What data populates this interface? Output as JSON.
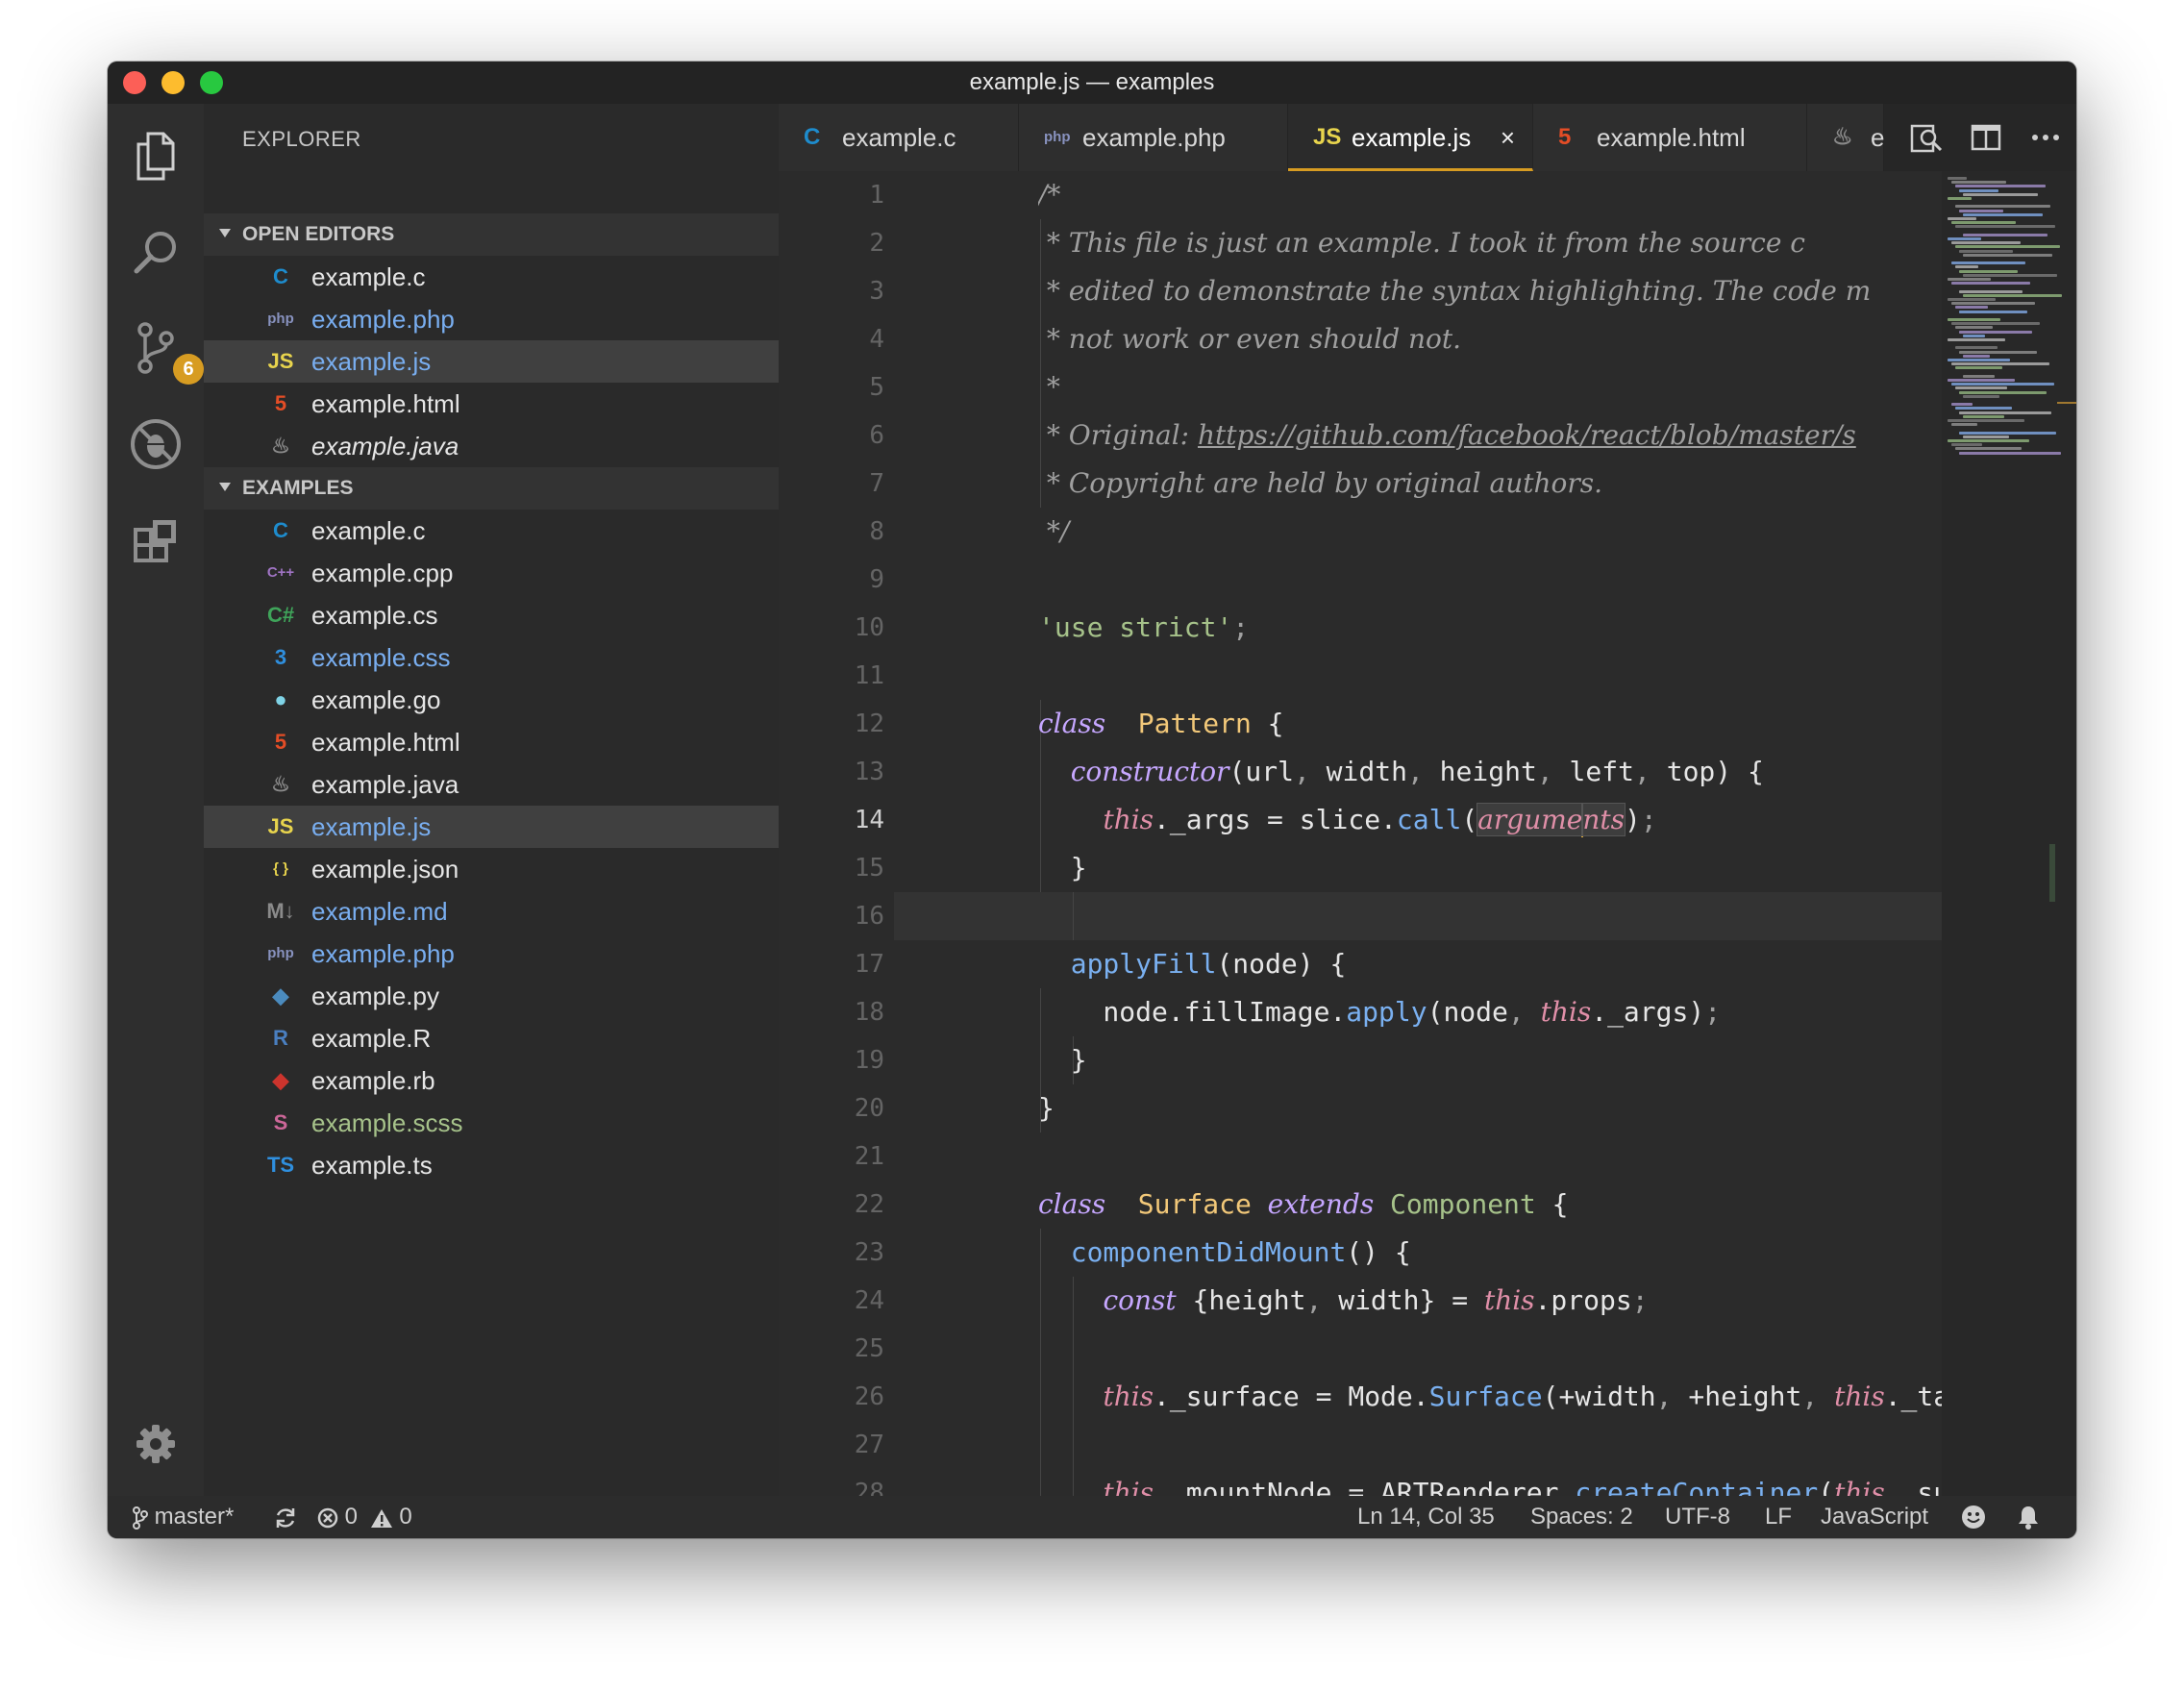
{
  "window": {
    "title": "example.js — examples"
  },
  "activity_bar": {
    "items": [
      {
        "icon": "explorer-icon",
        "active": true
      },
      {
        "icon": "search-icon"
      },
      {
        "icon": "source-control-icon",
        "badge": "6"
      },
      {
        "icon": "debug-icon"
      },
      {
        "icon": "extensions-icon"
      }
    ],
    "settings_icon": "gear-icon"
  },
  "sidebar": {
    "title": "EXPLORER",
    "open_editors": {
      "header": "OPEN EDITORS",
      "items": [
        {
          "name": "example.c",
          "icon": "C",
          "icon_color": "#1e8ccd",
          "text_color": "#e6e6e6"
        },
        {
          "name": "example.php",
          "icon": "php",
          "icon_color": "#8892bf",
          "text_color": "#79aef0"
        },
        {
          "name": "example.js",
          "icon": "JS",
          "icon_color": "#e8d44d",
          "text_color": "#79aef0",
          "selected": true
        },
        {
          "name": "example.html",
          "icon": "5",
          "icon_color": "#e44d26",
          "text_color": "#e6e6e6"
        },
        {
          "name": "example.java",
          "icon": "♨",
          "icon_color": "#8a8a8a",
          "text_color": "#e6e6e6",
          "italic": true
        }
      ]
    },
    "examples": {
      "header": "EXAMPLES",
      "items": [
        {
          "name": "example.c",
          "icon": "C",
          "icon_color": "#1e8ccd",
          "text_color": "#e6e6e6"
        },
        {
          "name": "example.cpp",
          "icon": "C++",
          "icon_color": "#a074c4",
          "text_color": "#e6e6e6"
        },
        {
          "name": "example.cs",
          "icon": "C#",
          "icon_color": "#3fa45a",
          "text_color": "#e6e6e6"
        },
        {
          "name": "example.css",
          "icon": "3",
          "icon_color": "#2f8fde",
          "text_color": "#79aef0"
        },
        {
          "name": "example.go",
          "icon": "●",
          "icon_color": "#7fd3e6",
          "text_color": "#e6e6e6"
        },
        {
          "name": "example.html",
          "icon": "5",
          "icon_color": "#e44d26",
          "text_color": "#e6e6e6"
        },
        {
          "name": "example.java",
          "icon": "♨",
          "icon_color": "#8a8a8a",
          "text_color": "#e6e6e6"
        },
        {
          "name": "example.js",
          "icon": "JS",
          "icon_color": "#e8d44d",
          "text_color": "#79aef0",
          "selected": true
        },
        {
          "name": "example.json",
          "icon": "{ }",
          "icon_color": "#e8d44d",
          "text_color": "#e6e6e6"
        },
        {
          "name": "example.md",
          "icon": "M↓",
          "icon_color": "#8a8a8a",
          "text_color": "#79aef0"
        },
        {
          "name": "example.php",
          "icon": "php",
          "icon_color": "#8892bf",
          "text_color": "#79aef0"
        },
        {
          "name": "example.py",
          "icon": "◆",
          "icon_color": "#4b8bbe",
          "text_color": "#e6e6e6"
        },
        {
          "name": "example.R",
          "icon": "R",
          "icon_color": "#4a7fc0",
          "text_color": "#e6e6e6"
        },
        {
          "name": "example.rb",
          "icon": "◆",
          "icon_color": "#cc342d",
          "text_color": "#e6e6e6"
        },
        {
          "name": "example.scss",
          "icon": "S",
          "icon_color": "#cd6799",
          "text_color": "#a6c28a"
        },
        {
          "name": "example.ts",
          "icon": "TS",
          "icon_color": "#2f8fde",
          "text_color": "#e6e6e6"
        }
      ]
    }
  },
  "tabs": [
    {
      "label": "example.c",
      "icon": "C",
      "icon_color": "#1e8ccd"
    },
    {
      "label": "example.php",
      "icon": "php",
      "icon_color": "#8892bf"
    },
    {
      "label": "example.js",
      "icon": "JS",
      "icon_color": "#e8d44d",
      "active": true,
      "close": "×"
    },
    {
      "label": "example.html",
      "icon": "5",
      "icon_color": "#e44d26"
    },
    {
      "label": "e",
      "icon": "♨",
      "icon_color": "#8a8a8a"
    }
  ],
  "tab_actions": [
    "open-preview-icon",
    "split-editor-icon",
    "more-actions-icon"
  ],
  "editor": {
    "current_line": 14,
    "lines": [
      [
        [
          "c",
          "/*"
        ]
      ],
      [
        [
          "c",
          " * This file is just an example. I took it from the source c"
        ]
      ],
      [
        [
          "c",
          " * edited to demonstrate the syntax highlighting. The code m"
        ]
      ],
      [
        [
          "c",
          " * not work or even should not."
        ]
      ],
      [
        [
          "c",
          " *"
        ]
      ],
      [
        [
          "c",
          " * Original: "
        ],
        [
          "c link",
          "https://github.com/facebook/react/blob/master/s"
        ]
      ],
      [
        [
          "c",
          " * Copyright are held by original authors."
        ]
      ],
      [
        [
          "c",
          " */"
        ]
      ],
      [],
      [
        [
          "str",
          "'use strict'"
        ],
        [
          "punct",
          ";"
        ]
      ],
      [],
      [
        [
          "kw",
          "class"
        ],
        [
          "",
          "  "
        ],
        [
          "cls",
          "Pattern"
        ],
        [
          "",
          " {"
        ]
      ],
      [
        [
          "",
          "  "
        ],
        [
          "kw",
          "constructor"
        ],
        [
          "",
          "(url"
        ],
        [
          "punct",
          ","
        ],
        [
          "",
          " width"
        ],
        [
          "punct",
          ","
        ],
        [
          "",
          " height"
        ],
        [
          "punct",
          ","
        ],
        [
          "",
          " left"
        ],
        [
          "punct",
          ","
        ],
        [
          "",
          " top) {"
        ]
      ],
      [
        [
          "",
          "    "
        ],
        [
          "thisk",
          "this"
        ],
        [
          "",
          "._args = slice."
        ],
        [
          "fn2",
          "call"
        ],
        [
          "",
          "("
        ],
        [
          "prm word-hl",
          "argume"
        ],
        [
          "caret",
          ""
        ],
        [
          "prm word-hl",
          "nts"
        ],
        [
          "",
          ")"
        ],
        [
          "punct",
          ";"
        ]
      ],
      [
        [
          "",
          "  }"
        ]
      ],
      [],
      [
        [
          "",
          "  "
        ],
        [
          "fn2",
          "applyFill"
        ],
        [
          "",
          "(node) {"
        ]
      ],
      [
        [
          "",
          "    node.fillImage."
        ],
        [
          "fn2",
          "apply"
        ],
        [
          "",
          "(node"
        ],
        [
          "punct",
          ","
        ],
        [
          "",
          " "
        ],
        [
          "thisk",
          "this"
        ],
        [
          "",
          "._args)"
        ],
        [
          "punct",
          ";"
        ]
      ],
      [
        [
          "",
          "  }"
        ]
      ],
      [
        [
          "",
          "}"
        ]
      ],
      [],
      [
        [
          "kw",
          "class"
        ],
        [
          "",
          "  "
        ],
        [
          "cls",
          "Surface"
        ],
        [
          "",
          " "
        ],
        [
          "kw",
          "extends"
        ],
        [
          "",
          " "
        ],
        [
          "ext",
          "Component"
        ],
        [
          "",
          " {"
        ]
      ],
      [
        [
          "",
          "  "
        ],
        [
          "fn2",
          "componentDidMount"
        ],
        [
          "",
          "() {"
        ]
      ],
      [
        [
          "",
          "    "
        ],
        [
          "kw",
          "const"
        ],
        [
          "",
          " {height"
        ],
        [
          "punct",
          ","
        ],
        [
          "",
          " width} = "
        ],
        [
          "thisk",
          "this"
        ],
        [
          "",
          ".props"
        ],
        [
          "punct",
          ";"
        ]
      ],
      [],
      [
        [
          "",
          "    "
        ],
        [
          "thisk",
          "this"
        ],
        [
          "",
          "._surface = Mode."
        ],
        [
          "fn2",
          "Surface"
        ],
        [
          "",
          "(+width"
        ],
        [
          "punct",
          ","
        ],
        [
          "",
          " +height"
        ],
        [
          "punct",
          ","
        ],
        [
          "",
          " "
        ],
        [
          "thisk",
          "this"
        ],
        [
          "",
          "._tagR"
        ]
      ],
      [],
      [
        [
          "",
          "    "
        ],
        [
          "thisk",
          "this"
        ],
        [
          "",
          "._mountNode = ARTRenderer."
        ],
        [
          "fn2",
          "createContainer"
        ],
        [
          "",
          "("
        ],
        [
          "thisk",
          "this"
        ],
        [
          "punct",
          ","
        ],
        [
          "",
          " surf"
        ]
      ]
    ]
  },
  "statusbar": {
    "branch": "master*",
    "errors": "0",
    "warnings": "0",
    "position": "Ln 14, Col 35",
    "spaces": "Spaces: 2",
    "encoding": "UTF-8",
    "eol": "LF",
    "language": "JavaScript"
  }
}
